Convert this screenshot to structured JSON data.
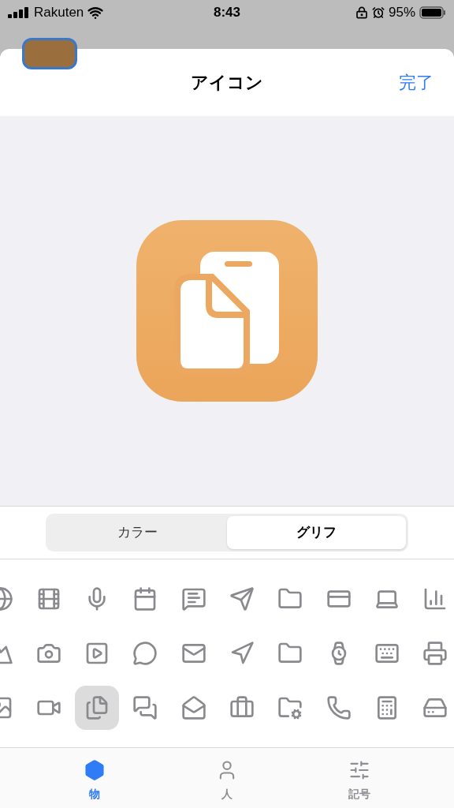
{
  "status_bar": {
    "carrier": "Rakuten",
    "time": "8:43",
    "battery": "95%"
  },
  "sheet": {
    "title": "アイコン",
    "done": "完了"
  },
  "segments": [
    {
      "label": "カラー",
      "selected": false
    },
    {
      "label": "グリフ",
      "selected": true
    }
  ],
  "glyph_grid": [
    [
      {
        "selected": false
      },
      {
        "selected": false
      },
      {
        "selected": false
      },
      {
        "selected": false
      },
      {
        "selected": false
      },
      {
        "selected": false
      },
      {
        "selected": false
      },
      {
        "selected": false
      },
      {
        "selected": false
      },
      {
        "selected": false
      }
    ],
    [
      {
        "selected": false
      },
      {
        "selected": false
      },
      {
        "selected": false
      },
      {
        "selected": false
      },
      {
        "selected": false
      },
      {
        "selected": false
      },
      {
        "selected": false
      },
      {
        "selected": false
      },
      {
        "selected": false
      },
      {
        "selected": false
      }
    ],
    [
      {
        "selected": false
      },
      {
        "selected": false
      },
      {
        "selected": true
      },
      {
        "selected": false
      },
      {
        "selected": false
      },
      {
        "selected": false
      },
      {
        "selected": false
      },
      {
        "selected": false
      },
      {
        "selected": false
      },
      {
        "selected": false
      }
    ]
  ],
  "tab_bar": [
    {
      "label": "物",
      "selected": true
    },
    {
      "label": "人",
      "selected": false
    },
    {
      "label": "記号",
      "selected": false
    }
  ]
}
